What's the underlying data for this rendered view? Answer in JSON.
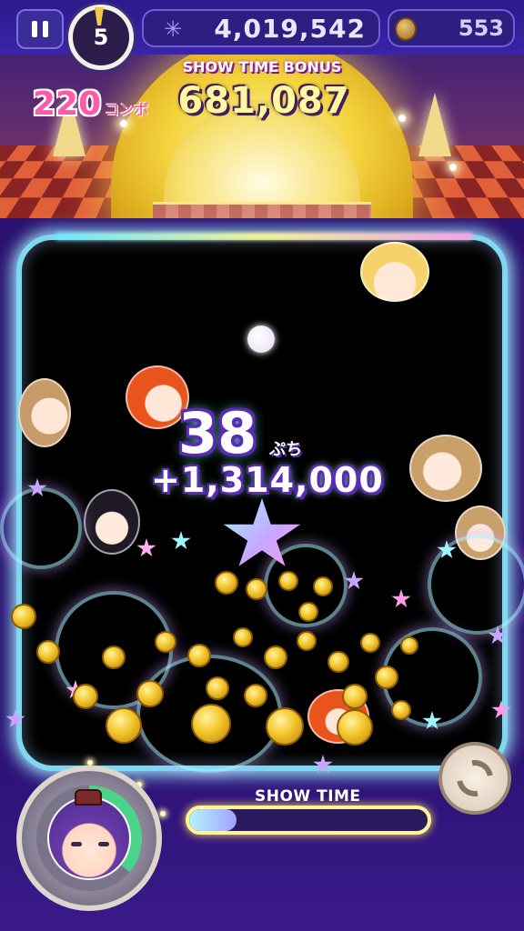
{
  "hud": {
    "level": "5",
    "score": "4,019,542",
    "coins": "553"
  },
  "stage": {
    "bonus_label": "SHOW TIME BONUS",
    "bonus_value": "681,087",
    "combo_count": "220",
    "combo_unit": "コンボ"
  },
  "board": {
    "chain_count": "38",
    "chain_unit": "ぷち",
    "chain_score": "+1,314,000"
  },
  "controls": {
    "showtime_label": "SHOW TIME",
    "showtime_progress": 0.2,
    "skill_charge": 0.36
  },
  "colors": {
    "hud_bg": "#2a1a8c",
    "board_border": "#7fd8f0",
    "combo": "#ff5aa8",
    "bonus_value": "#fff8a0",
    "coin": "#f3c52a"
  },
  "icons": [
    "pause-icon",
    "level-flag-icon",
    "snowflake-icon",
    "coin-icon",
    "shuffle-icon",
    "star-item-icon"
  ]
}
